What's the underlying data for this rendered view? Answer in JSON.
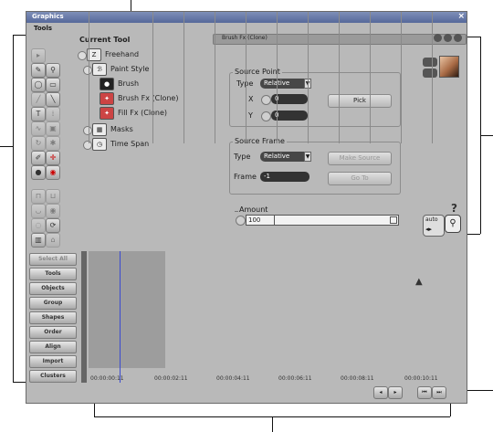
{
  "window": {
    "title": "Graphics",
    "close_glyph": "×"
  },
  "tools": {
    "tab_label": "Tools",
    "icons": [
      "pointer-icon",
      "node-select-icon",
      "lasso-icon",
      "nodes-icon",
      "ellipse-icon",
      "rectangle-icon",
      "pencil-icon",
      "line-icon",
      "text-icon",
      "vertical-text-icon",
      "freehand-icon",
      "cube-icon",
      "rotate-icon",
      "star-icon",
      "eyedropper-icon",
      "crosshair-icon",
      "stamp-icon",
      "record-icon",
      "lock-icon",
      "unlock-icon",
      "hide-icon",
      "show-icon",
      "group-icon",
      "refresh-icon",
      "layers-icon",
      "trash-icon"
    ]
  },
  "tree": {
    "header": "Current Tool",
    "items": [
      {
        "label": "Freehand",
        "icon": "freehand-tool-icon"
      },
      {
        "label": "Paint Style",
        "icon": "paint-style-icon"
      },
      {
        "label": "Brush",
        "icon": "brush-icon"
      },
      {
        "label": "Brush Fx (Clone)",
        "icon": "brush-fx-icon"
      },
      {
        "label": "Fill Fx (Clone)",
        "icon": "fill-fx-icon"
      },
      {
        "label": "Masks",
        "icon": "masks-icon"
      },
      {
        "label": "Time Span",
        "icon": "time-span-icon"
      }
    ]
  },
  "panel": {
    "title": "Brush Fx (Clone)",
    "source_point": {
      "label": "Source Point",
      "type_label": "Type",
      "type_value": "Relative",
      "x_label": "X",
      "x_value": "0",
      "y_label": "Y",
      "y_value": "0",
      "pick_label": "Pick"
    },
    "source_frame": {
      "label": "Source Frame",
      "type_label": "Type",
      "type_value": "Relative",
      "make_source_label": "Make Source",
      "frame_label": "Frame",
      "frame_value": "-1",
      "goto_label": "Go To"
    },
    "amount": {
      "label": "Amount",
      "value": "100",
      "fill": 0.0
    },
    "help_glyph": "?",
    "auto_label": "auto"
  },
  "bottom_buttons": [
    "Select All",
    "Tools",
    "Objects",
    "Group",
    "Shapes",
    "Order",
    "Align",
    "Import",
    "Clusters"
  ],
  "timeline": {
    "labels": [
      "00:00:00:11",
      "00:00:02:11",
      "00:00:04:11",
      "00:00:06:11",
      "00:00:08:11",
      "00:00:10:11"
    ],
    "transport": [
      "prev-keyframe-icon",
      "next-keyframe-icon",
      "first-frame-icon",
      "last-frame-icon"
    ]
  }
}
